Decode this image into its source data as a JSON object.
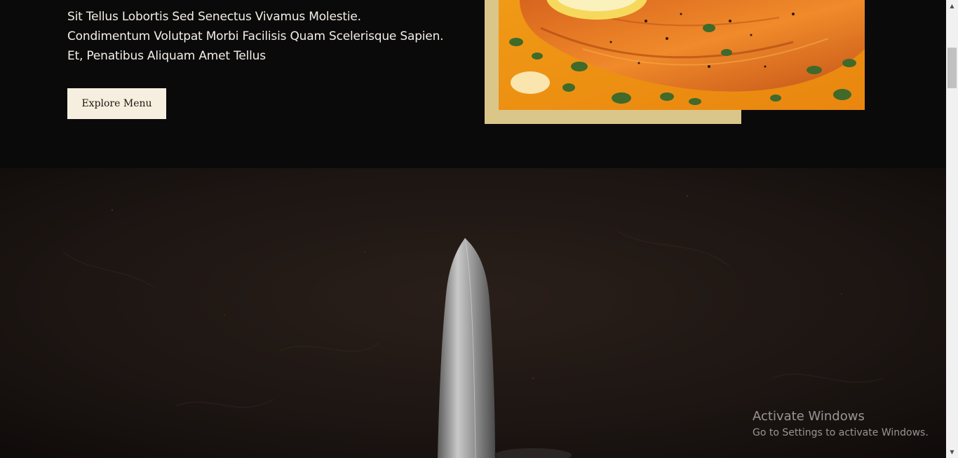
{
  "about": {
    "description": "Sit Tellus Lobortis Sed Senectus Vivamus Molestie. Condimentum Volutpat Morbi Facilisis Quam Scelerisque Sapien. Et, Penatibus Aliquam Amet Tellus",
    "explore_button_label": "Explore Menu",
    "food_image_subject": "grilled-fish-with-lemon-and-herbs",
    "frame_color": "#dbc68a"
  },
  "chef_section": {
    "background_image_subject": "kitchen-knife-on-dark-surface"
  },
  "watermark": {
    "title": "Activate Windows",
    "subtitle": "Go to Settings to activate Windows."
  },
  "scrollbar": {
    "up_icon": "up-arrow-icon",
    "down_icon": "down-arrow-icon"
  },
  "colors": {
    "page_background": "#0b0a0b",
    "button_background": "#f6efdf",
    "button_text": "#1d140f",
    "body_text": "#f3efe6",
    "food_sauce": "#e98a15"
  }
}
